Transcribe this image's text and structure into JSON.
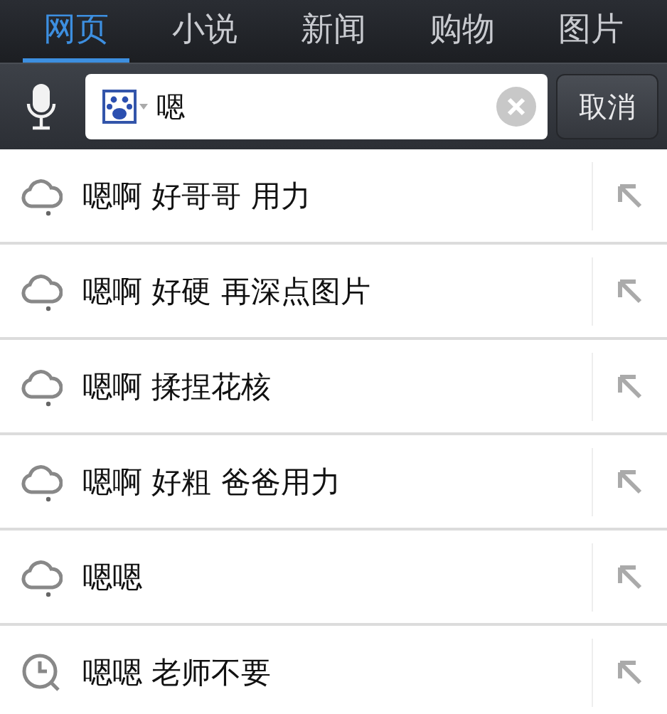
{
  "tabs": [
    {
      "label": "网页",
      "selected": true
    },
    {
      "label": "小说",
      "selected": false
    },
    {
      "label": "新闻",
      "selected": false
    },
    {
      "label": "购物",
      "selected": false
    },
    {
      "label": "图片",
      "selected": false
    }
  ],
  "search": {
    "value": "嗯",
    "cancel": "取消"
  },
  "suggestions": [
    {
      "kind": "suggestion",
      "text": "嗯啊 好哥哥 用力"
    },
    {
      "kind": "suggestion",
      "text": "嗯啊 好硬 再深点图片"
    },
    {
      "kind": "suggestion",
      "text": "嗯啊 揉捏花核"
    },
    {
      "kind": "suggestion",
      "text": "嗯啊 好粗 爸爸用力"
    },
    {
      "kind": "suggestion",
      "text": "嗯嗯"
    },
    {
      "kind": "history",
      "text": "嗯嗯 老师不要"
    }
  ]
}
